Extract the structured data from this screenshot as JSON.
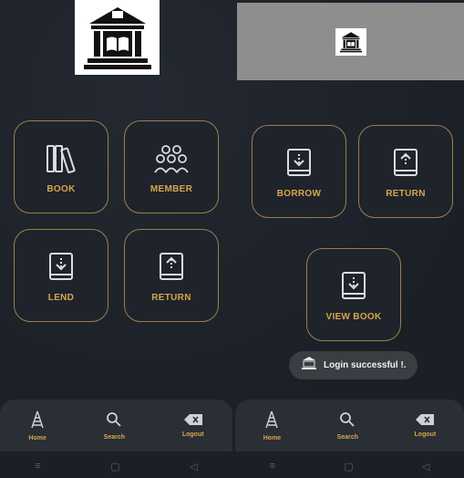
{
  "left_screen": {
    "tiles": [
      {
        "label": "BOOK",
        "icon": "books-icon"
      },
      {
        "label": "MEMBER",
        "icon": "members-icon"
      },
      {
        "label": "LEND",
        "icon": "book-download-icon"
      },
      {
        "label": "RETURN",
        "icon": "book-upload-icon"
      }
    ],
    "nav": [
      {
        "label": "Home",
        "icon": "tower-icon"
      },
      {
        "label": "Search",
        "icon": "search-icon"
      },
      {
        "label": "Logout",
        "icon": "backspace-icon"
      }
    ]
  },
  "right_screen": {
    "tiles": [
      {
        "label": "BORROW",
        "icon": "book-download-icon"
      },
      {
        "label": "RETURN",
        "icon": "book-upload-icon"
      },
      {
        "label": "VIEW BOOK",
        "icon": "book-download-icon"
      }
    ],
    "toast": "Login successful !.",
    "nav": [
      {
        "label": "Home",
        "icon": "tower-icon"
      },
      {
        "label": "Search",
        "icon": "search-icon"
      },
      {
        "label": "Logout",
        "icon": "backspace-icon"
      }
    ]
  },
  "system_nav": [
    "≡",
    "▢",
    "◁"
  ],
  "colors": {
    "accent": "#d5a64b",
    "tile_border": "#9a7f4f",
    "background": "#1c2027"
  }
}
